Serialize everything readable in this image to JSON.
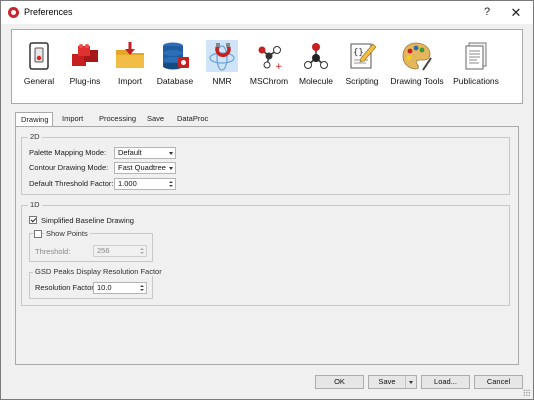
{
  "window": {
    "title": "Preferences",
    "help_glyph": "?",
    "close_glyph": "✕"
  },
  "categories": [
    {
      "label": "General",
      "icon": "switch-icon"
    },
    {
      "label": "Plug-ins",
      "icon": "bricks-icon"
    },
    {
      "label": "Import",
      "icon": "folder-import-icon"
    },
    {
      "label": "Database",
      "icon": "database-icon"
    },
    {
      "label": "NMR",
      "icon": "nmr-magnet-icon",
      "selected": true
    },
    {
      "label": "MSChrom",
      "icon": "mschrom-icon"
    },
    {
      "label": "Molecule",
      "icon": "molecule-icon"
    },
    {
      "label": "Scripting",
      "icon": "script-icon"
    },
    {
      "label": "Drawing Tools",
      "icon": "palette-icon"
    },
    {
      "label": "Publications",
      "icon": "publications-icon"
    }
  ],
  "tabs": [
    {
      "label": "Drawing",
      "active": true
    },
    {
      "label": "Import"
    },
    {
      "label": "Processing"
    },
    {
      "label": "Save"
    },
    {
      "label": "DataProc"
    }
  ],
  "group_2d": {
    "title": "2D",
    "palette_label": "Palette Mapping Mode:",
    "palette_value": "Default",
    "contour_label": "Contour Drawing Mode:",
    "contour_value": "Fast Quadtree",
    "threshold_label": "Default Threshold Factor:",
    "threshold_value": "1.000"
  },
  "group_1d": {
    "title": "1D",
    "baseline_label": "Simplified Baseline Drawing",
    "baseline_checked": true,
    "show_points_label": "Show Points",
    "show_points_checked": false,
    "threshold_label": "Threshold:",
    "threshold_value": "256",
    "gsd_title": "GSD Peaks Display Resolution Factor",
    "resolution_label": "Resolution Factor:",
    "resolution_value": "10.0"
  },
  "buttons": {
    "ok": "OK",
    "save": "Save",
    "load": "Load...",
    "cancel": "Cancel"
  },
  "colors": {
    "accent_red": "#c8262c",
    "selection": "#cfe4f7"
  }
}
